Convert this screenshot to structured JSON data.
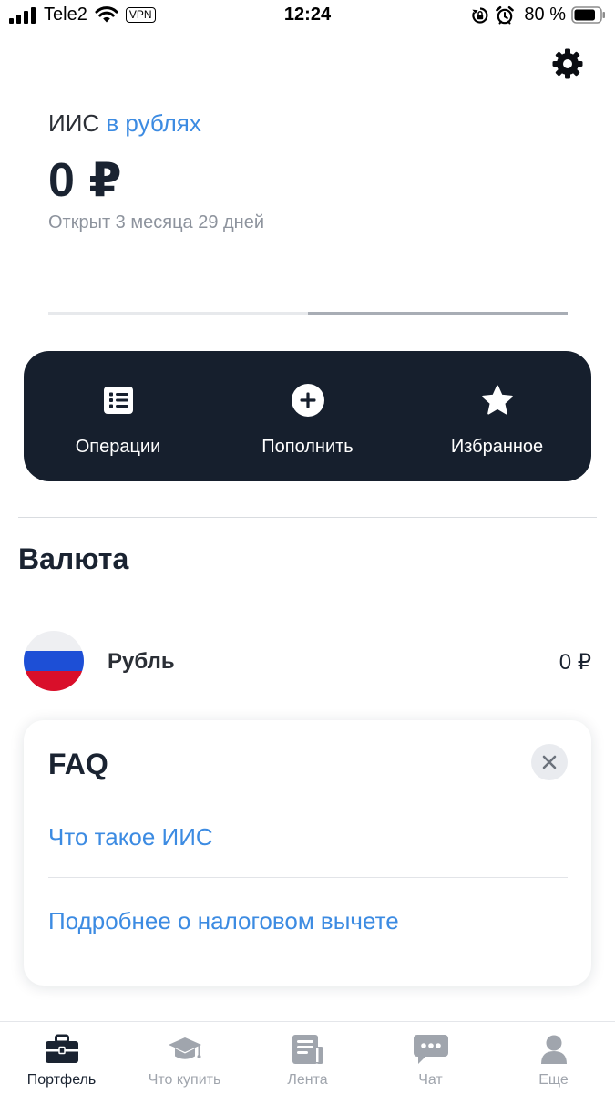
{
  "status_bar": {
    "carrier": "Tele2",
    "vpn": "VPN",
    "time": "12:24",
    "battery": "80 %",
    "icons": [
      "signal-icon",
      "wifi-icon",
      "rotation-lock-icon",
      "alarm-icon",
      "battery-icon"
    ]
  },
  "header": {
    "settings_icon": "gear-icon"
  },
  "account": {
    "name_prefix": "ИИС",
    "currency_link": "в рублях",
    "balance": "0 ₽",
    "opened": "Открыт 3 месяца 29 дней"
  },
  "pager": {
    "pages": 2,
    "current": 2
  },
  "actions": [
    {
      "label": "Операции",
      "icon": "list-icon"
    },
    {
      "label": "Пополнить",
      "icon": "plus-circle-icon"
    },
    {
      "label": "Избранное",
      "icon": "star-icon"
    }
  ],
  "currency_section": {
    "title": "Валюта",
    "items": [
      {
        "name": "Рубль",
        "amount": "0 ₽",
        "icon": "russia-flag-icon"
      }
    ]
  },
  "faq": {
    "title": "FAQ",
    "links": [
      "Что такое ИИС",
      "Подробнее о налоговом вычете"
    ]
  },
  "tab_bar": {
    "active": 0,
    "tabs": [
      {
        "label": "Портфель",
        "icon": "briefcase-icon"
      },
      {
        "label": "Что купить",
        "icon": "graduation-cap-icon"
      },
      {
        "label": "Лента",
        "icon": "newspaper-icon"
      },
      {
        "label": "Чат",
        "icon": "chat-bubble-icon"
      },
      {
        "label": "Еще",
        "icon": "user-icon"
      }
    ]
  },
  "colors": {
    "accent": "#3c8be2",
    "dark_panel": "#161f2d",
    "text_primary": "#1a2331",
    "text_secondary": "#8d939d",
    "tab_inactive": "#a0a5ad"
  }
}
